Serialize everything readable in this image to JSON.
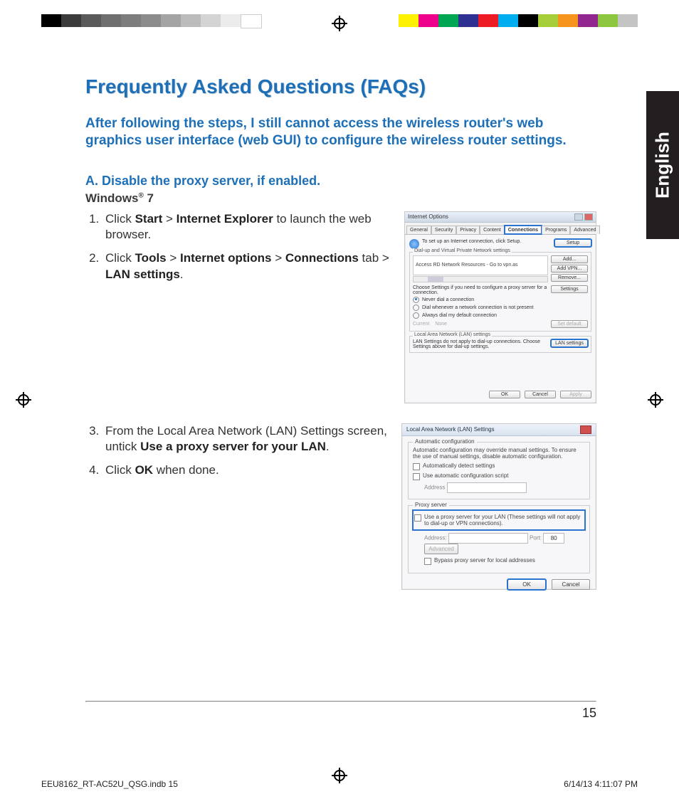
{
  "language_tab": "English",
  "title": "Frequently Asked Questions (FAQs)",
  "subtitle": "After following the steps, I still cannot access the wireless router's web graphics user interface (web GUI) to configure the wireless router settings.",
  "sectionA": "A.   Disable the proxy server, if enabled.",
  "os_label": "Windows® 7",
  "steps1": {
    "s1_a": "Click ",
    "s1_b": "Start",
    "s1_c": " > ",
    "s1_d": "Internet Explorer",
    "s1_e": " to launch the web browser.",
    "s2_a": "Click ",
    "s2_b": "Tools",
    "s2_c": " > ",
    "s2_d": "Internet options",
    "s2_e": " >  ",
    "s2_f": "Connections",
    "s2_g": " tab > ",
    "s2_h": "LAN settings",
    "s2_i": "."
  },
  "steps2": {
    "s3_a": "From the Local Area Network (LAN)     Settings screen, untick ",
    "s3_b": "Use a proxy server for your LAN",
    "s3_c": ".",
    "s4_a": "Click ",
    "s4_b": "OK",
    "s4_c": " when done."
  },
  "shot1": {
    "title": "Internet Options",
    "tabs": [
      "General",
      "Security",
      "Privacy",
      "Content",
      "Connections",
      "Programs",
      "Advanced"
    ],
    "setup_text": "To set up an Internet connection, click Setup.",
    "btn_setup": "Setup",
    "grp_dialup": "Dial-up and Virtual Private Network settings",
    "list_item": "Access RD Network Resources - Go to vpn.as",
    "btn_add": "Add...",
    "btn_addvpn": "Add VPN...",
    "btn_remove": "Remove...",
    "choose_text": "Choose Settings if you need to configure a proxy server for a connection.",
    "btn_settings": "Settings",
    "rad1": "Never dial a connection",
    "rad2": "Dial whenever a network connection is not present",
    "rad3": "Always dial my default connection",
    "cur_lbl": "Current",
    "cur_val": "None",
    "btn_setdef": "Set default",
    "grp_lan": "Local Area Network (LAN) settings",
    "lan_text": "LAN Settings do not apply to dial-up connections. Choose Settings above for dial-up settings.",
    "btn_lan": "LAN settings",
    "btn_ok": "OK",
    "btn_cancel": "Cancel",
    "btn_apply": "Apply"
  },
  "shot2": {
    "title": "Local Area Network (LAN) Settings",
    "grp_auto": "Automatic configuration",
    "auto_text": "Automatic configuration may override manual settings. To ensure the use of manual settings, disable automatic configuration.",
    "chk_auto": "Automatically detect settings",
    "chk_script": "Use automatic configuration script",
    "lbl_addr1": "Address",
    "grp_proxy": "Proxy server",
    "chk_proxy": "Use a proxy server for your LAN (These settings will not apply to dial-up or VPN connections).",
    "lbl_addr2": "Address:",
    "lbl_port": "Port:",
    "port_val": "80",
    "btn_adv": "Advanced",
    "chk_bypass": "Bypass proxy server for local addresses",
    "btn_ok": "OK",
    "btn_cancel": "Cancel"
  },
  "page_number": "15",
  "imprint_left": "EEU8162_RT-AC52U_QSG.indb   15",
  "imprint_right": "6/14/13   4:11:07 PM",
  "colors": {
    "gray_bars": [
      "#000000",
      "#3b3b3b",
      "#5a5a5a",
      "#6f6f6f",
      "#7d7d7d",
      "#8c8c8c",
      "#a4a4a4",
      "#bcbcbc",
      "#d4d4d4",
      "#ececec",
      "#ffffff"
    ],
    "right_bars": [
      "#fff200",
      "#ec008c",
      "#00a651",
      "#2e3192",
      "#ed1c24",
      "#00aeef",
      "#000000",
      "#a6ce39",
      "#f7941d",
      "#92278f",
      "#8dc63f",
      "#c4c4c4"
    ]
  }
}
